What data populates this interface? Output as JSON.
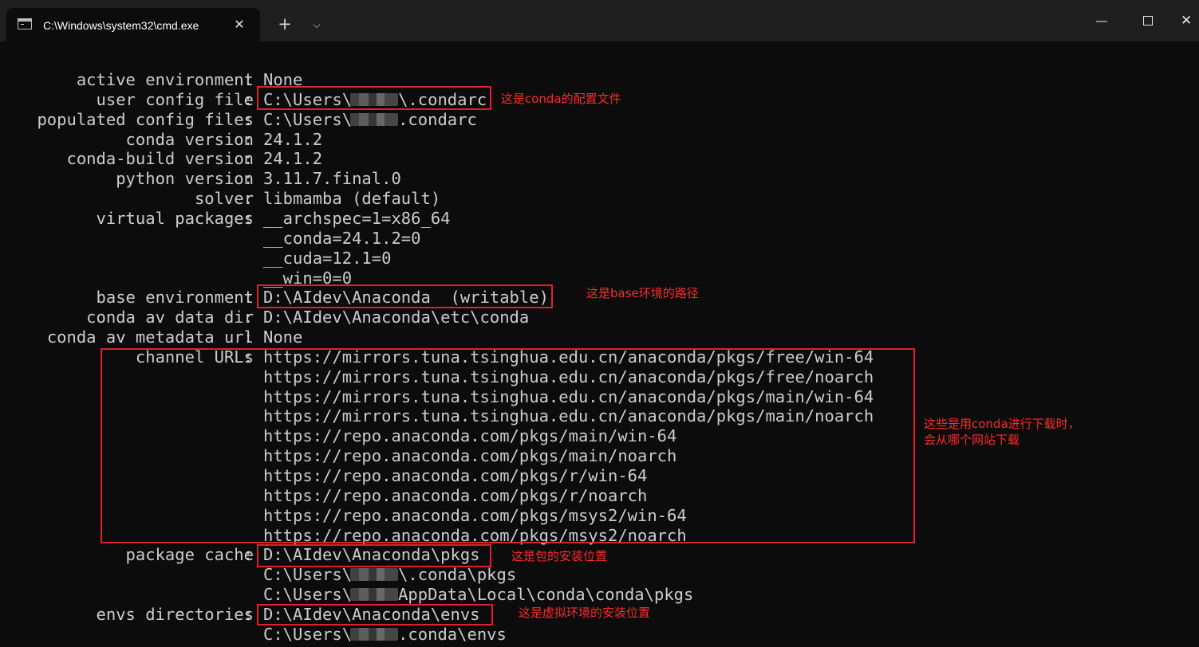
{
  "window": {
    "tab_title": "C:\\Windows\\system32\\cmd.exe",
    "tab_close_glyph": "✕",
    "new_tab_glyph": "+",
    "dropdown_glyph": "⌵",
    "minimize_glyph": "—",
    "close_glyph": "✕"
  },
  "console": {
    "lines": [
      {
        "label": "active environment",
        "colon": ":",
        "value": "None"
      },
      {
        "label": "user config file",
        "colon": ":",
        "value_prefix": "C:\\Users\\",
        "value_suffix": "\\.condarc"
      },
      {
        "label": "populated config files",
        "colon": ":",
        "value_prefix": "C:\\Users\\",
        "value_suffix": ".condarc"
      },
      {
        "label": "conda version",
        "colon": ":",
        "value": "24.1.2"
      },
      {
        "label": "conda-build version",
        "colon": ":",
        "value": "24.1.2"
      },
      {
        "label": "python version",
        "colon": ":",
        "value": "3.11.7.final.0"
      },
      {
        "label": "solver",
        "colon": ":",
        "value": "libmamba (default)"
      },
      {
        "label": "virtual packages",
        "colon": ":",
        "value": "__archspec=1=x86_64"
      },
      {
        "label": "",
        "colon": "",
        "value": "__conda=24.1.2=0"
      },
      {
        "label": "",
        "colon": "",
        "value": "__cuda=12.1=0"
      },
      {
        "label": "",
        "colon": "",
        "value": "__win=0=0"
      },
      {
        "label": "base environment",
        "colon": ":",
        "value": "D:\\AIdev\\Anaconda  (writable)"
      },
      {
        "label": "conda av data dir",
        "colon": ":",
        "value": "D:\\AIdev\\Anaconda\\etc\\conda"
      },
      {
        "label": "conda av metadata url",
        "colon": ":",
        "value": "None"
      },
      {
        "label": "channel URLs",
        "colon": ":",
        "value": "https://mirrors.tuna.tsinghua.edu.cn/anaconda/pkgs/free/win-64"
      },
      {
        "label": "",
        "colon": "",
        "value": "https://mirrors.tuna.tsinghua.edu.cn/anaconda/pkgs/free/noarch"
      },
      {
        "label": "",
        "colon": "",
        "value": "https://mirrors.tuna.tsinghua.edu.cn/anaconda/pkgs/main/win-64"
      },
      {
        "label": "",
        "colon": "",
        "value": "https://mirrors.tuna.tsinghua.edu.cn/anaconda/pkgs/main/noarch"
      },
      {
        "label": "",
        "colon": "",
        "value": "https://repo.anaconda.com/pkgs/main/win-64"
      },
      {
        "label": "",
        "colon": "",
        "value": "https://repo.anaconda.com/pkgs/main/noarch"
      },
      {
        "label": "",
        "colon": "",
        "value": "https://repo.anaconda.com/pkgs/r/win-64"
      },
      {
        "label": "",
        "colon": "",
        "value": "https://repo.anaconda.com/pkgs/r/noarch"
      },
      {
        "label": "",
        "colon": "",
        "value": "https://repo.anaconda.com/pkgs/msys2/win-64"
      },
      {
        "label": "",
        "colon": "",
        "value": "https://repo.anaconda.com/pkgs/msys2/noarch"
      },
      {
        "label": "package cache",
        "colon": ":",
        "value": "D:\\AIdev\\Anaconda\\pkgs"
      },
      {
        "label": "",
        "colon": "",
        "value_prefix": "C:\\Users\\",
        "value_suffix": "\\.conda\\pkgs"
      },
      {
        "label": "",
        "colon": "",
        "value_prefix": "C:\\Users\\",
        "value_suffix": "AppData\\Local\\conda\\conda\\pkgs"
      },
      {
        "label": "envs directories",
        "colon": ":",
        "value": "D:\\AIdev\\Anaconda\\envs"
      },
      {
        "label": "",
        "colon": "",
        "value_prefix": "C:\\Users\\",
        "value_suffix": ".conda\\envs"
      }
    ]
  },
  "annotations": {
    "config_file": "这是conda的配置文件",
    "base_env": "这是base环境的路径",
    "channels": "这些是用conda进行下载时，\n会从哪个网站下载",
    "pkgs": "这是包的安装位置",
    "envs": "这是虚拟环境的安装位置",
    "color": "#ff2a2a"
  },
  "colors": {
    "terminal_bg": "#0c0c0c",
    "terminal_text": "#cccccc",
    "titlebar_bg": "#1f1f1f",
    "highlight_box": "#e0202a"
  }
}
